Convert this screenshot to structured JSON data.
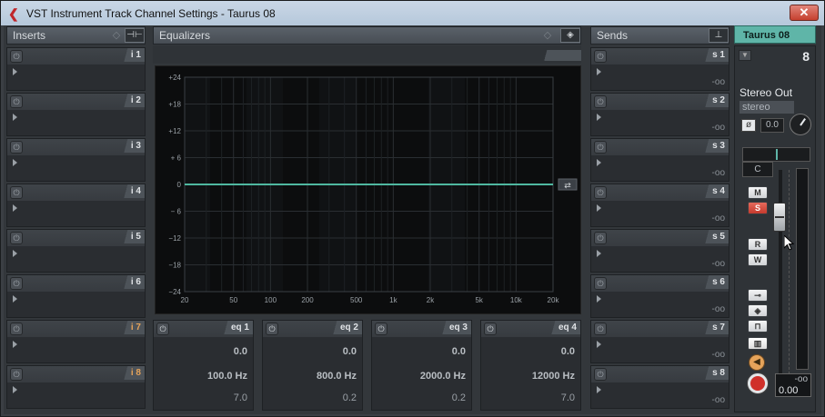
{
  "window": {
    "title": "VST Instrument Track Channel Settings - Taurus 08",
    "close_glyph": "✕"
  },
  "inserts": {
    "title": "Inserts",
    "slots": [
      {
        "label": "i 1",
        "highlight": false
      },
      {
        "label": "i 2",
        "highlight": false
      },
      {
        "label": "i 3",
        "highlight": false
      },
      {
        "label": "i 4",
        "highlight": false
      },
      {
        "label": "i 5",
        "highlight": false
      },
      {
        "label": "i 6",
        "highlight": false
      },
      {
        "label": "i 7",
        "highlight": true
      },
      {
        "label": "i 8",
        "highlight": true
      }
    ]
  },
  "equalizers": {
    "title": "Equalizers",
    "y_axis": [
      "+24",
      "+18",
      "+12",
      "+ 6",
      "0",
      "− 6",
      "−12",
      "−18",
      "−24"
    ],
    "x_axis": [
      "20",
      "50",
      "100",
      "200",
      "500",
      "1k",
      "2k",
      "5k",
      "10k",
      "20k"
    ],
    "bands": [
      {
        "label": "eq 1",
        "gain": "0.0",
        "freq": "100.0 Hz",
        "q": "7.0"
      },
      {
        "label": "eq 2",
        "gain": "0.0",
        "freq": "800.0 Hz",
        "q": "0.2"
      },
      {
        "label": "eq 3",
        "gain": "0.0",
        "freq": "2000.0 Hz",
        "q": "0.2"
      },
      {
        "label": "eq 4",
        "gain": "0.0",
        "freq": "12000 Hz",
        "q": "7.0"
      }
    ]
  },
  "sends": {
    "title": "Sends",
    "slots": [
      {
        "label": "s 1",
        "value": "-oo"
      },
      {
        "label": "s 2",
        "value": "-oo"
      },
      {
        "label": "s 3",
        "value": "-oo"
      },
      {
        "label": "s 4",
        "value": "-oo"
      },
      {
        "label": "s 5",
        "value": "-oo"
      },
      {
        "label": "s 6",
        "value": "-oo"
      },
      {
        "label": "s 7",
        "value": "-oo"
      },
      {
        "label": "s 8",
        "value": "-oo"
      }
    ]
  },
  "channel": {
    "name": "Taurus 08",
    "number": "8",
    "output": "Stereo Out",
    "output_mode": "stereo",
    "input_gain": "0.0",
    "pan": "C",
    "buttons": {
      "mute": "M",
      "solo": "S",
      "read": "R",
      "write": "W"
    },
    "meter_peak": "-oo",
    "volume": "0.00"
  },
  "colors": {
    "accent": "#5fb5a8",
    "eq_curve": "#4fb8a0",
    "orange": "#e5a35a",
    "record": "#d0302a"
  }
}
